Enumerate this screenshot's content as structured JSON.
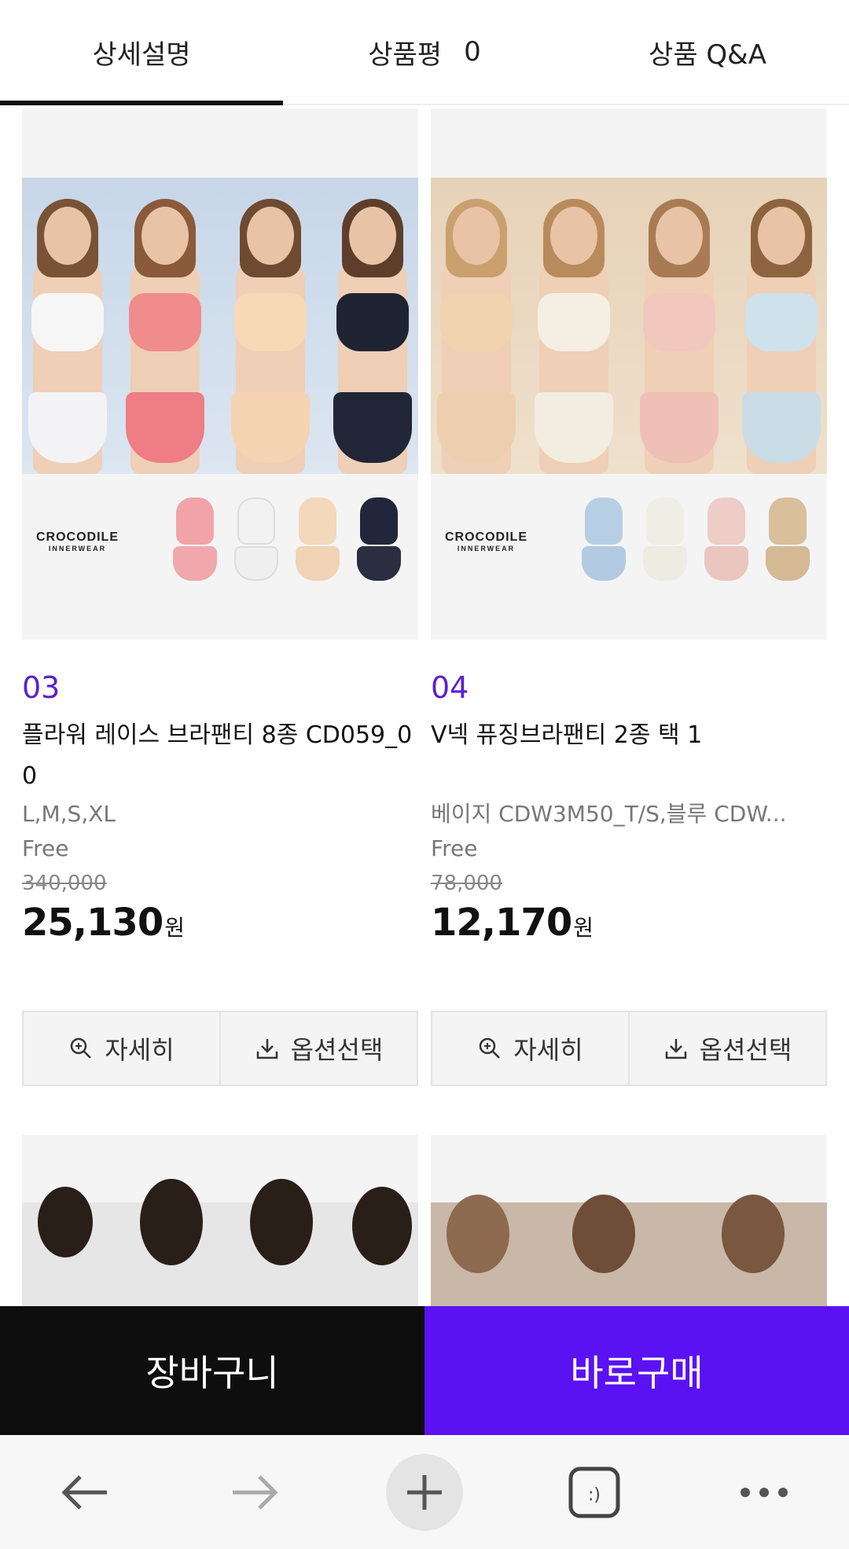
{
  "tabs": [
    {
      "label": "상세설명",
      "active": true
    },
    {
      "label": "상품평",
      "count": "0"
    },
    {
      "label": "상품 Q&A"
    }
  ],
  "products": [
    {
      "index": "03",
      "title": "플라워 레이스 브라팬티 8종 CD059_00",
      "option_line1": "L,M,S,XL",
      "option_line2": "Free",
      "original_price": "340,000",
      "price": "25,130",
      "currency": "원",
      "brand": "CROCODILE",
      "brand_sub": "INNERWEAR",
      "detail_label": "자세히",
      "option_label": "옵션선택"
    },
    {
      "index": "04",
      "title": "V넥 퓨징브라팬티 2종 택 1",
      "option_line1": "베이지 CDW3M50_T/S,블루 CDW...",
      "option_line2": "Free",
      "original_price": "78,000",
      "price": "12,170",
      "currency": "원",
      "brand": "CROCODILE",
      "brand_sub": "INNERWEAR",
      "detail_label": "자세히",
      "option_label": "옵션선택"
    }
  ],
  "actions": {
    "cart_label": "장바구니",
    "buy_label": "바로구매"
  },
  "nav_icons": [
    "back-arrow-icon",
    "forward-arrow-icon",
    "plus-icon",
    "tabs-icon",
    "more-icon"
  ],
  "colors": {
    "accent": "#5a12f2",
    "index_color": "#5a1fd1",
    "cart_bg": "#0e0e0e"
  }
}
